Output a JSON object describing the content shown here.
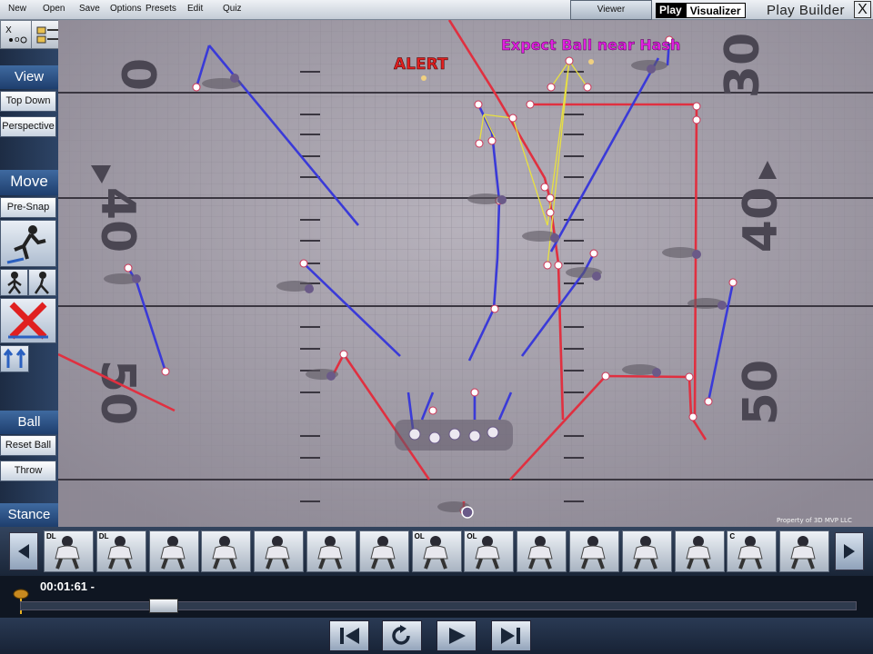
{
  "menu": {
    "items": [
      "New",
      "Open",
      "Save",
      "Options",
      "Presets",
      "Edit",
      "Quiz"
    ],
    "viewer_label": "Viewer",
    "brand_a": "Play",
    "brand_b": "Visualizer",
    "title": "Play  Builder",
    "close": "X"
  },
  "sidebar": {
    "view_head": "View",
    "top_down": "Top Down",
    "perspective": "Perspective",
    "move_head": "Move",
    "pre_snap": "Pre-Snap",
    "ball_head": "Ball",
    "reset_ball": "Reset  Ball",
    "throw": "Throw",
    "stance_head": "Stance"
  },
  "field": {
    "alert": "ALERT",
    "expect": "Expect Ball near Hash",
    "yard_left": [
      "0",
      "40",
      "50"
    ],
    "yard_right": [
      "30",
      "40",
      "50"
    ],
    "property": "Property  of  3D  MVP  LLC",
    "colors": {
      "route_blue": "#3a3ad8",
      "route_red": "#e03040",
      "read_yellow": "#e8e040",
      "alert_red": "#e02020",
      "expect_magenta": "#e020e0"
    }
  },
  "strip": {
    "labels": [
      "DL",
      "DL",
      "",
      "",
      "",
      "",
      "",
      "OL",
      "OL",
      "",
      "",
      "",
      "",
      "C",
      ""
    ]
  },
  "timeline": {
    "time": "00:01:61 -",
    "progress": 0.16
  }
}
